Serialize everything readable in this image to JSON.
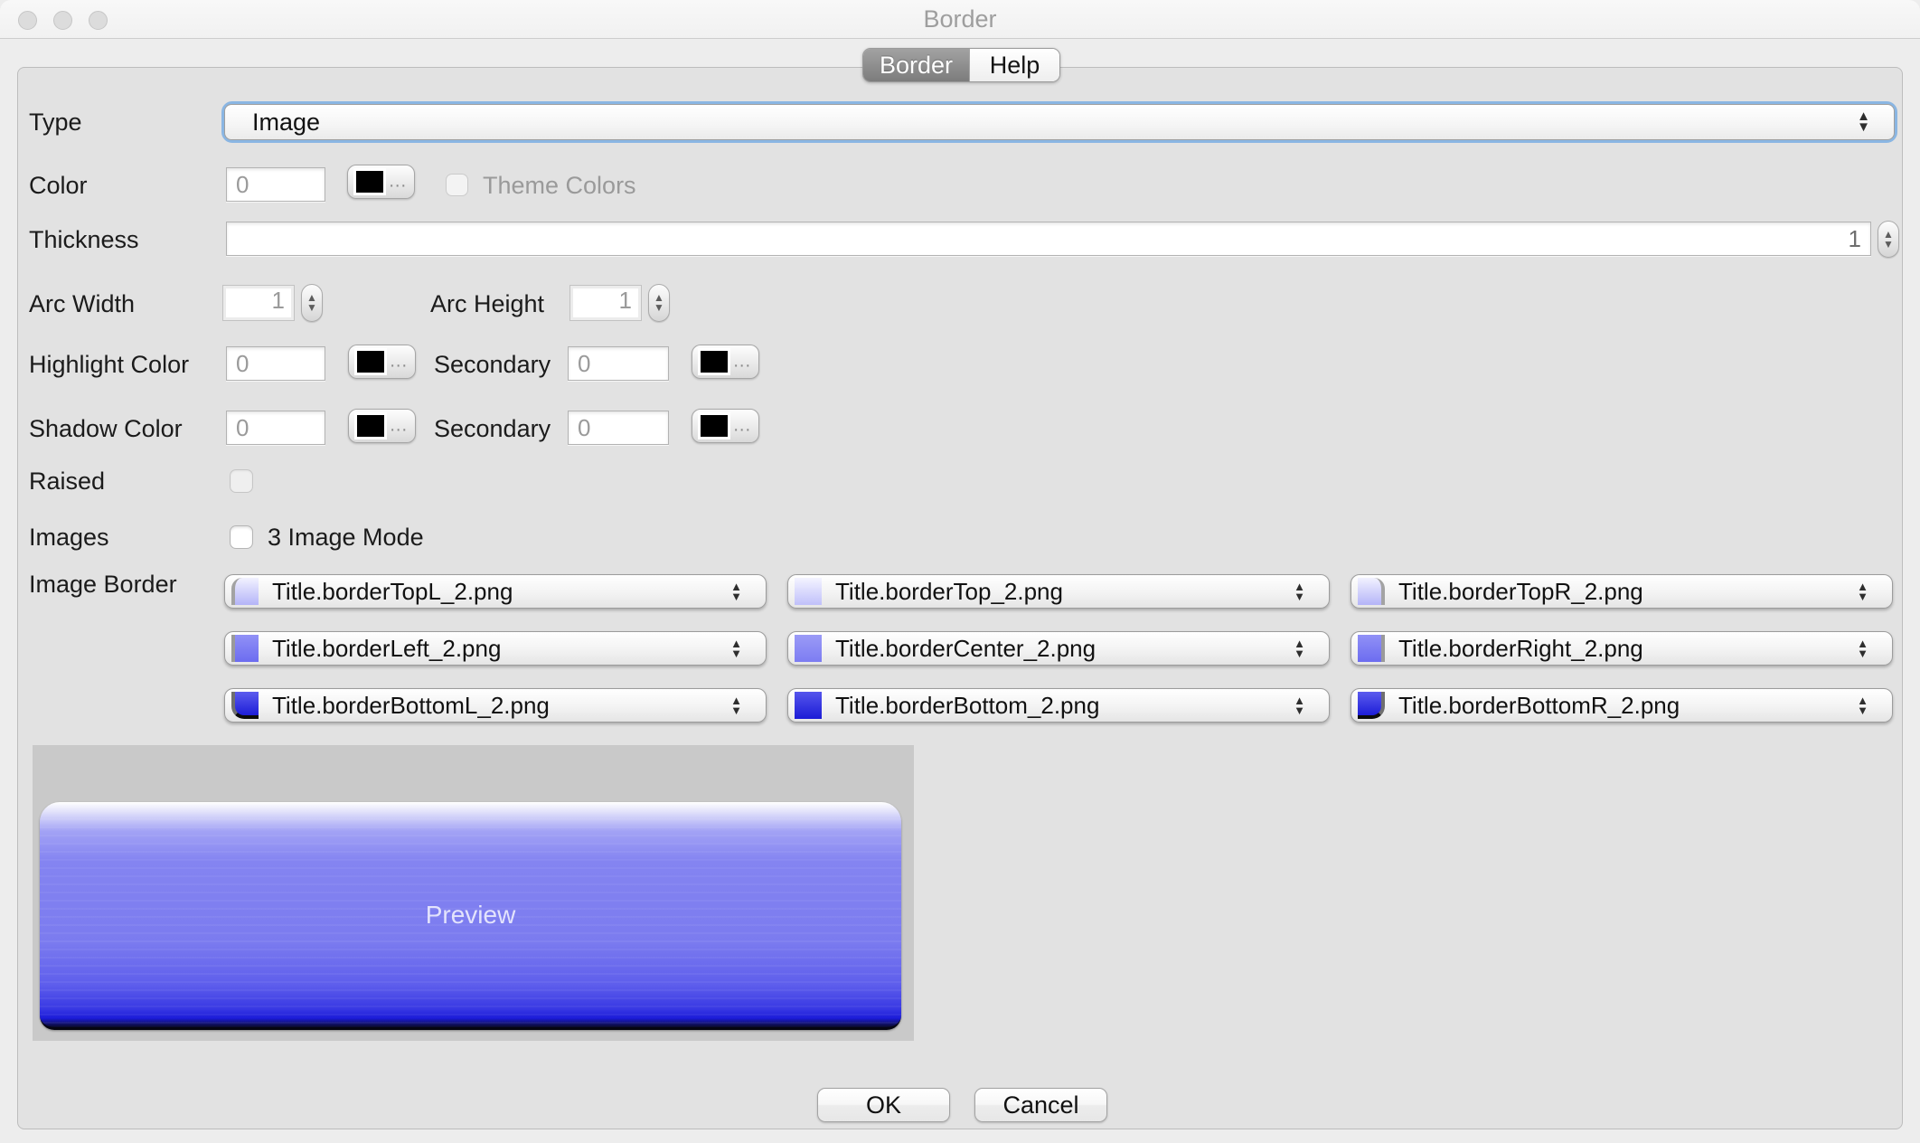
{
  "window": {
    "title": "Border"
  },
  "window_controls": [
    "close",
    "minimize",
    "zoom"
  ],
  "tabs": [
    {
      "label": "Border",
      "active": true
    },
    {
      "label": "Help",
      "active": false
    }
  ],
  "icons": {
    "combo_up": "▲",
    "combo_down": "▼",
    "spinner_up": "▲",
    "spinner_down": "▼"
  },
  "swatch_ellipsis": "...",
  "form": {
    "type": {
      "label": "Type",
      "value": "Image"
    },
    "color": {
      "label": "Color",
      "value": "0",
      "swatch_color": "#000000",
      "theme_colors_label": "Theme Colors",
      "theme_colors_checked": false
    },
    "thickness": {
      "label": "Thickness",
      "value": "1"
    },
    "arc": {
      "width_label": "Arc Width",
      "width_value": "1",
      "height_label": "Arc Height",
      "height_value": "1"
    },
    "highlight": {
      "label": "Highlight Color",
      "value": "0",
      "swatch_color": "#000000",
      "secondary_label": "Secondary",
      "secondary_value": "0",
      "secondary_swatch_color": "#000000"
    },
    "shadow": {
      "label": "Shadow Color",
      "value": "0",
      "swatch_color": "#000000",
      "secondary_label": "Secondary",
      "secondary_value": "0",
      "secondary_swatch_color": "#000000"
    },
    "raised": {
      "label": "Raised",
      "checked": false
    },
    "images": {
      "label": "Images",
      "mode_label": "3 Image Mode",
      "checked": false
    },
    "image_border": {
      "label": "Image Border",
      "cells": [
        {
          "filename": "Title.borderTopL_2.png",
          "thumb": "top-left-corner-image"
        },
        {
          "filename": "Title.borderTop_2.png",
          "thumb": "top-edge-image"
        },
        {
          "filename": "Title.borderTopR_2.png",
          "thumb": "top-right-corner-image"
        },
        {
          "filename": "Title.borderLeft_2.png",
          "thumb": "left-edge-image"
        },
        {
          "filename": "Title.borderCenter_2.png",
          "thumb": "center-image"
        },
        {
          "filename": "Title.borderRight_2.png",
          "thumb": "right-edge-image"
        },
        {
          "filename": "Title.borderBottomL_2.png",
          "thumb": "bottom-left-corner-image"
        },
        {
          "filename": "Title.borderBottom_2.png",
          "thumb": "bottom-edge-image"
        },
        {
          "filename": "Title.borderBottomR_2.png",
          "thumb": "bottom-right-corner-image"
        }
      ]
    }
  },
  "preview": {
    "label": "Preview"
  },
  "buttons": {
    "ok": "OK",
    "cancel": "Cancel"
  }
}
